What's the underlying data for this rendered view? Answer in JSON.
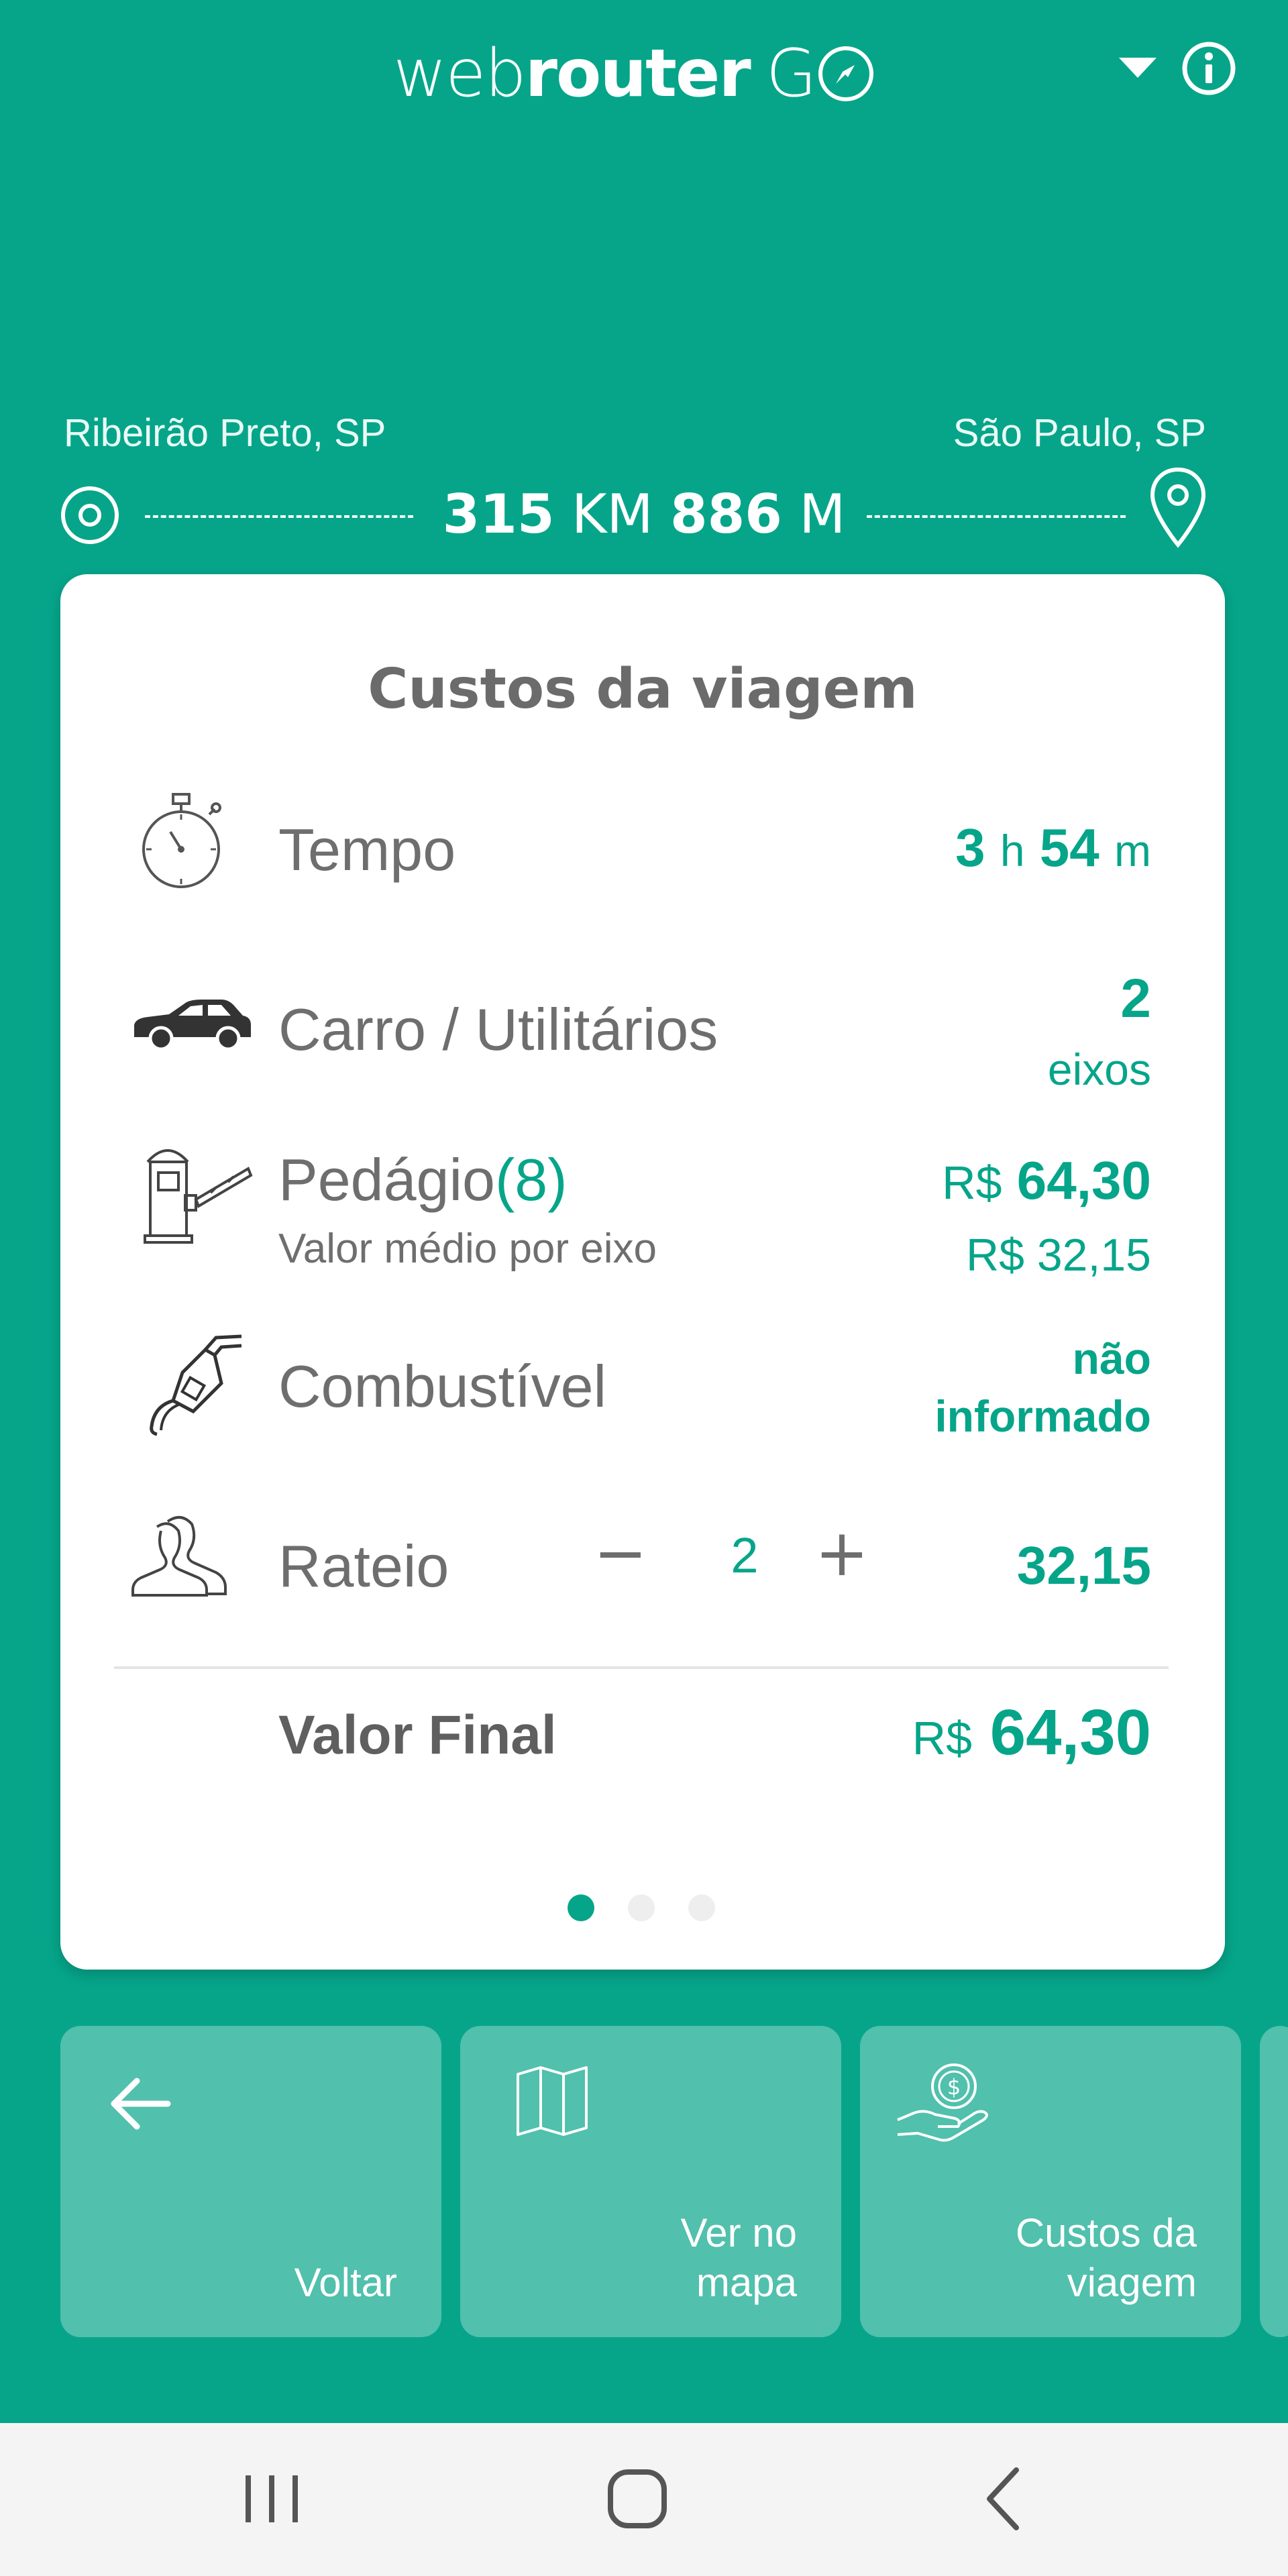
{
  "header": {
    "logo_web": "web",
    "logo_router": "router",
    "logo_go": "G",
    "dropdown_icon": "caret-down-icon",
    "info_icon": "info-circle-icon"
  },
  "route": {
    "origin": "Ribeirão Preto, SP",
    "destination": "São Paulo, SP",
    "distance_km": "315",
    "distance_km_unit": "KM",
    "distance_m": "886",
    "distance_m_unit": "M"
  },
  "card": {
    "title": "Custos da viagem",
    "tempo": {
      "label": "Tempo",
      "hours": "3",
      "hours_unit": "h",
      "minutes": "54",
      "minutes_unit": "m"
    },
    "vehicle": {
      "label": "Carro / Utilitários",
      "axles": "2",
      "axles_unit": "eixos"
    },
    "pedagio": {
      "label": "Pedágio",
      "count": "(8)",
      "sublabel": "Valor médio por eixo",
      "currency": "R$",
      "total": "64,30",
      "per_axle": "R$ 32,15"
    },
    "combustivel": {
      "label": "Combustível",
      "value_line1": "não",
      "value_line2": "informado"
    },
    "rateio": {
      "label": "Rateio",
      "minus": "−",
      "count": "2",
      "plus": "+",
      "value": "32,15"
    },
    "final": {
      "label": "Valor Final",
      "currency": "R$",
      "value": "64,30"
    },
    "pagination": {
      "total": 3,
      "active": 1
    }
  },
  "tiles": [
    {
      "label": "Voltar",
      "icon": "arrow-left-icon"
    },
    {
      "label": "Ver no\nmapa",
      "icon": "folded-map-icon"
    },
    {
      "label": "Custos da\nviagem",
      "icon": "money-hand-icon"
    }
  ],
  "colors": {
    "brand": "#06a58a",
    "text_gray": "#6e6e6e",
    "card_bg": "#ffffff",
    "navbar_bg": "#f4f4f4"
  }
}
